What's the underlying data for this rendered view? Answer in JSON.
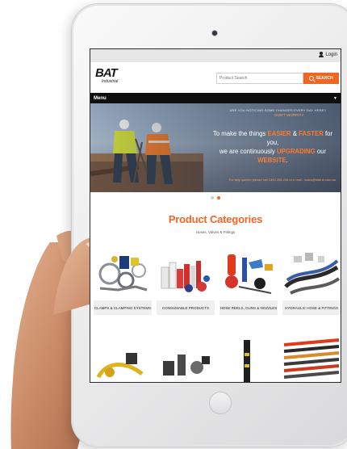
{
  "topbar": {
    "login_label": "Login"
  },
  "header": {
    "logo_main": "BAT",
    "logo_sub": "Industrial",
    "search_placeholder": "Product Search",
    "search_button": "SEARCH"
  },
  "menu": {
    "label": "Menu",
    "caret": "▼"
  },
  "hero": {
    "line_small_1": "ARE YOU NOTICING SOME CHANGES EVERY DAY HERE?",
    "line_small_2": "DON'T WORRY!!!",
    "headline_parts": [
      "To make the things ",
      "EASIER",
      " & ",
      "FASTER",
      " for you,",
      "we are continuously ",
      "UPGRADING",
      " our ",
      "WEBSITE",
      "."
    ],
    "contact": "For any queries please call 1300 228 228 or e-mail - sales@batind.com.au"
  },
  "carousel": {
    "slides": 2,
    "active": 2
  },
  "categories_section": {
    "title": "Product Categories",
    "subtitle": "Hoses, Valves & Fittings",
    "items": [
      {
        "label": "CLAMPS & CLAMPING SYSTEMS"
      },
      {
        "label": "CONSUMABLE PRODUCTS"
      },
      {
        "label": "HOSE REELS, GUNS & NOZZLES"
      },
      {
        "label": "HYDRAULIC HOSE & FITTINGS"
      }
    ]
  },
  "colors": {
    "accent": "#f26522",
    "menu_bg": "#0f0f0f",
    "logo_red": "#e03a1e"
  }
}
